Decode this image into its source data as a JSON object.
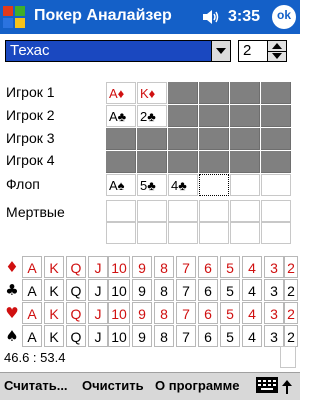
{
  "titlebar": {
    "title": "Покер Аналайзер",
    "time": "3:35",
    "ok_label": "ok"
  },
  "toolbar": {
    "game_value": "Техас",
    "players_value": "2"
  },
  "players": [
    {
      "label": "Игрок 1",
      "cards": [
        {
          "text": "A♦",
          "color": "red"
        },
        {
          "text": "K♦",
          "color": "red"
        }
      ]
    },
    {
      "label": "Игрок 2",
      "cards": [
        {
          "text": "A♣",
          "color": "black"
        },
        {
          "text": "2♣",
          "color": "black"
        }
      ]
    },
    {
      "label": "Игрок 3",
      "cards": []
    },
    {
      "label": "Игрок 4",
      "cards": []
    }
  ],
  "flop": {
    "label": "Флоп",
    "cards": [
      {
        "text": "A♠",
        "color": "black"
      },
      {
        "text": "5♣",
        "color": "black"
      },
      {
        "text": "4♣",
        "color": "black"
      }
    ]
  },
  "dead": {
    "label": "Мертвые"
  },
  "deck": {
    "ranks": [
      "A",
      "K",
      "Q",
      "J",
      "10",
      "9",
      "8",
      "7",
      "6",
      "5",
      "4",
      "3",
      "2"
    ],
    "suits": [
      {
        "symbol": "♦",
        "color": "red"
      },
      {
        "symbol": "♣",
        "color": "black"
      },
      {
        "symbol": "♥",
        "color": "red"
      },
      {
        "symbol": "♠",
        "color": "black"
      }
    ]
  },
  "result": "46.6 : 53.4",
  "menu": {
    "calculate": "Считать...",
    "clear": "Очистить",
    "about": "О программе"
  },
  "colors": {
    "titlebar": "#1460c8",
    "red": "#d01010",
    "dark_cell": "#808080"
  }
}
